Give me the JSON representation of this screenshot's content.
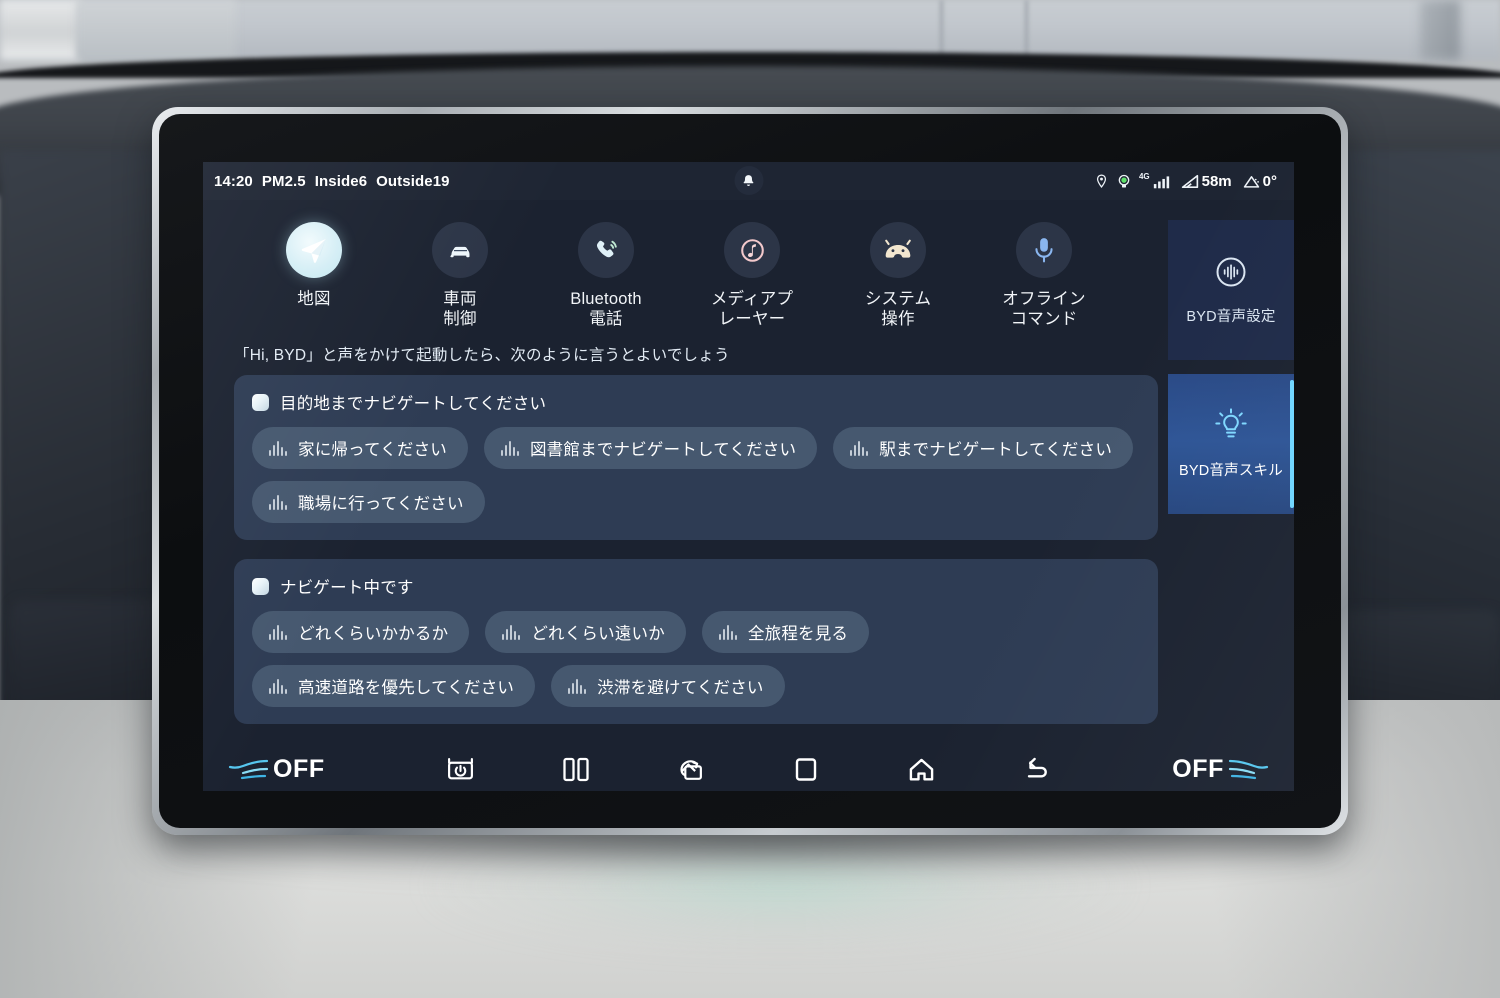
{
  "status_bar": {
    "time": "14:20",
    "pm25_label": "PM2.5",
    "inside_label": "Inside",
    "inside_value": "6",
    "outside_label": "Outside",
    "outside_value": "19",
    "network": "4G",
    "altitude": "58m",
    "incline": "0°",
    "location_icon": "location-pin-icon",
    "gps_icon": "gps-record-icon",
    "signal_icon": "signal-bars-icon",
    "altitude_icon": "altitude-icon",
    "incline_icon": "incline-icon",
    "notification_icon": "bell-icon"
  },
  "apps": [
    {
      "label_lines": [
        "地図"
      ],
      "icon": "navigation-arrow-icon",
      "highlighted": true
    },
    {
      "label_lines": [
        "車両",
        "制御"
      ],
      "icon": "car-icon",
      "highlighted": false
    },
    {
      "label_lines": [
        "Bluetooth",
        "電話"
      ],
      "icon": "phone-bluetooth-icon",
      "highlighted": false
    },
    {
      "label_lines": [
        "メディアプ",
        "レーヤー"
      ],
      "icon": "music-note-icon",
      "highlighted": false
    },
    {
      "label_lines": [
        "システム",
        "操作"
      ],
      "icon": "android-robot-icon",
      "highlighted": false
    },
    {
      "label_lines": [
        "オフライン",
        "コマンド"
      ],
      "icon": "microphone-icon",
      "highlighted": false
    }
  ],
  "hint": "「Hi, BYD」と声をかけて起動したら、次のように言うとよいでしょう",
  "cards": [
    {
      "title": "目的地までナビゲートしてください",
      "chips": [
        "家に帰ってください",
        "図書館までナビゲートしてください",
        "駅までナビゲートしてください",
        "職場に行ってください"
      ]
    },
    {
      "title": "ナビゲート中です",
      "chips": [
        "どれくらいかかるか",
        "どれくらい遠いか",
        "全旅程を見る",
        "高速道路を優先してください",
        "渋滞を避けてください"
      ]
    }
  ],
  "sidebar": {
    "items": [
      {
        "label": "BYD音声設定",
        "icon": "voice-waveform-circle-icon",
        "active": false
      },
      {
        "label": "BYD音声スキル",
        "icon": "lightbulb-icon",
        "active": true
      }
    ]
  },
  "navbar": {
    "left_climate": {
      "label": "OFF",
      "icon": "airflow-icon"
    },
    "right_climate": {
      "label": "OFF",
      "icon": "airflow-icon"
    },
    "buttons": [
      {
        "name": "seat-power-icon"
      },
      {
        "name": "split-screen-icon"
      },
      {
        "name": "screen-rotate-icon"
      },
      {
        "name": "recents-square-icon"
      },
      {
        "name": "home-icon"
      },
      {
        "name": "back-icon"
      }
    ]
  },
  "colors": {
    "screen_bg": "#1b2230",
    "card_bg": "#2e3c54",
    "chip_bg": "#46586f",
    "sidebar_bg": "#1f2b49",
    "sidebar_active": "#2e5596",
    "accent_cyan": "#6fd6ff",
    "status_bg": "#1e2533",
    "highlight_icon": "#d6eff6"
  }
}
